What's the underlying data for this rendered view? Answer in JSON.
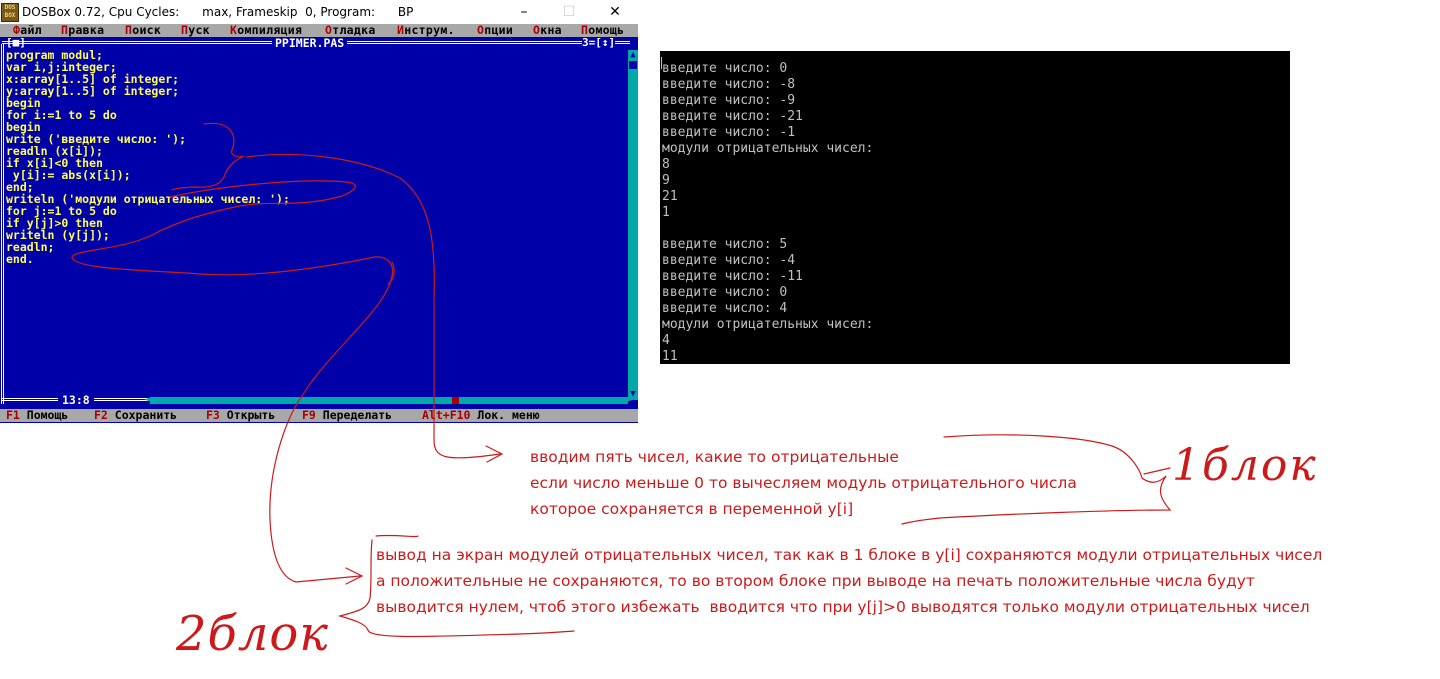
{
  "window": {
    "title": "DOSBox 0.72, Cpu Cycles:      max, Frameskip  0, Program:      BP",
    "icon": "DOS BOX",
    "controls": {
      "minimize": "–",
      "maximize": "☐",
      "close": "✕"
    }
  },
  "menubar": [
    {
      "hot": "Ф",
      "rest": "айл"
    },
    {
      "hot": "П",
      "rest": "равка"
    },
    {
      "hot": "П",
      "rest": "оиск"
    },
    {
      "hot": "П",
      "rest": "уск"
    },
    {
      "hot": "К",
      "rest": "омпиляция"
    },
    {
      "hot": "О",
      "rest": "тладка"
    },
    {
      "hot": "И",
      "rest": "нструм."
    },
    {
      "hot": "О",
      "rest": "пции"
    },
    {
      "hot": "О",
      "rest": "кна"
    },
    {
      "hot": "П",
      "rest": "омощь"
    }
  ],
  "editor": {
    "close_box": "[■]",
    "file_name": "PPIMER.PAS",
    "window_number": "3=[↕]",
    "cursor_position": "13:8",
    "code": [
      "program modul;",
      "var i,j:integer;",
      "x:array[1..5] of integer;",
      "y:array[1..5] of integer;",
      "begin",
      "for i:=1 to 5 do",
      "begin",
      "write ('введите число: ');",
      "readln (x[i]);",
      "if x[i]<0 then",
      " y[i]:= abs(x[i]);",
      "end;",
      "writeln ('модули отрицательных чисел: ');",
      "for j:=1 to 5 do",
      "if y[j]>0 then",
      "writeln (y[j]);",
      "readln;",
      "end."
    ]
  },
  "statusbar": [
    {
      "key": "F1",
      "label": " Помощь"
    },
    {
      "key": "F2",
      "label": " Сохранить"
    },
    {
      "key": "F3",
      "label": " Открыть"
    },
    {
      "key": "F9",
      "label": " Переделать"
    },
    {
      "key": "Alt+F10",
      "label": " Лок. меню"
    }
  ],
  "console": [
    "введите число: 0",
    "введите число: -8",
    "введите число: -9",
    "введите число: -21",
    "введите число: -1",
    "модули отрицательных чисел:",
    "8",
    "9",
    "21",
    "1",
    "",
    "введите число: 5",
    "введите число: -4",
    "введите число: -11",
    "введите число: 0",
    "введите число: 4",
    "модули отрицательных чисел:",
    "4",
    "11"
  ],
  "annotations": {
    "block1_text": [
      "вводим пять чисел, какие то отрицательные",
      "если число меньше 0 то вычесляем модуль отрицательного числа",
      "которое сохраняется в переменной у[i]"
    ],
    "block2_text": [
      "вывод на экран модулей отрицательных чисел, так как в 1 блоке в у[i] сохраняются модули отрицательных чисел",
      "а положительные не сохраняются, то во втором блоке при выводе на печать положительные числа будут",
      "выводится нулем, чтоб этого избежать  вводится что при у[j]>0 выводятся только модули отрицательных чисел"
    ],
    "label_1": "1блок",
    "label_2": "2блок",
    "ink_color": "#cc1a1a"
  }
}
